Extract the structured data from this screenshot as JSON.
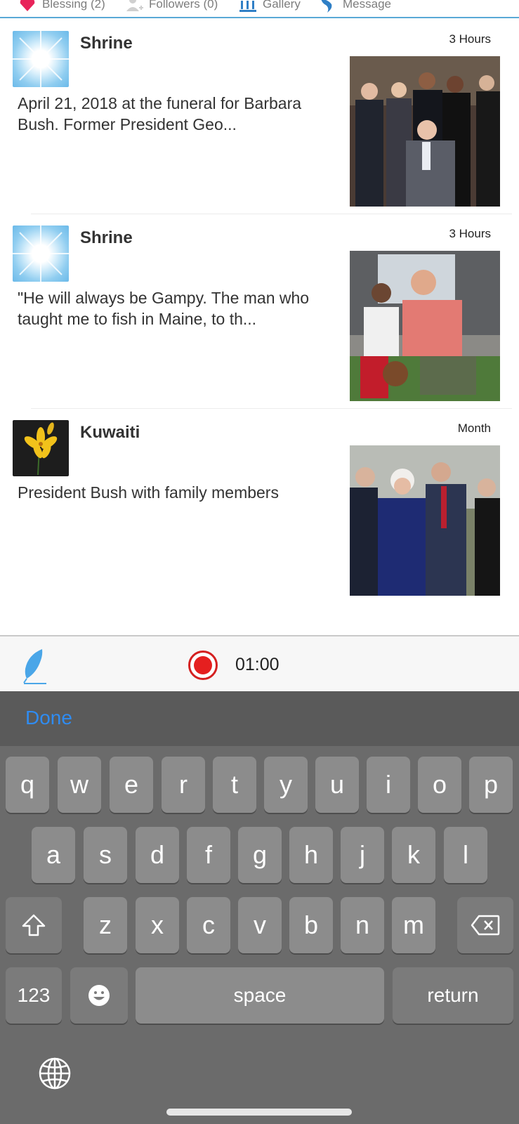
{
  "tabs": [
    {
      "label": "Blessing (2)",
      "icon": "heart-icon"
    },
    {
      "label": "Followers (0)",
      "icon": "add-user-icon"
    },
    {
      "label": "Gallery",
      "icon": "gallery-columns-icon"
    },
    {
      "label": "Message",
      "icon": "bird-icon"
    }
  ],
  "posts": [
    {
      "author": "Shrine",
      "time": "3 Hours",
      "text": "April 21, 2018 at the funeral for Barbara Bush. Former President Geo...",
      "avatar": "sunburst-avatar",
      "photo": "group-photo"
    },
    {
      "author": "Shrine",
      "time": "3 Hours",
      "text": "\"He will always be Gampy. The man who taught me to fish in Maine, to th...",
      "avatar": "sunburst-avatar",
      "photo": "outdoor-photo"
    },
    {
      "author": "Kuwaiti",
      "time": "Month",
      "text": "President Bush with family members",
      "avatar": "lily-avatar",
      "photo": "family-photo"
    }
  ],
  "recorder": {
    "time": "01:00",
    "icon_left": "feather-pen-icon",
    "record_icon": "record-icon"
  },
  "keyboard": {
    "done": "Done",
    "row1": [
      "q",
      "w",
      "e",
      "r",
      "t",
      "y",
      "u",
      "i",
      "o",
      "p"
    ],
    "row2": [
      "a",
      "s",
      "d",
      "f",
      "g",
      "h",
      "j",
      "k",
      "l"
    ],
    "row3": [
      "z",
      "x",
      "c",
      "v",
      "b",
      "n",
      "m"
    ],
    "numbers": "123",
    "space": "space",
    "return": "return"
  },
  "colors": {
    "accent": "#2f8cf2",
    "tab_line": "#5aa9d6",
    "record": "#e51f1f",
    "heart": "#e8245a"
  }
}
